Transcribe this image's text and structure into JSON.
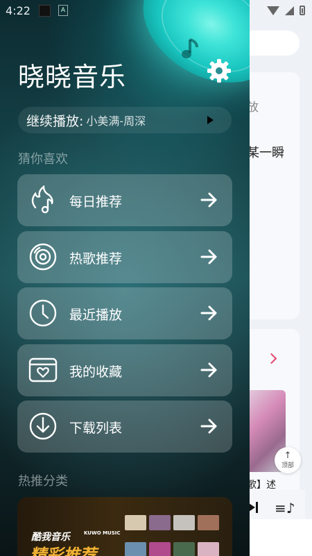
{
  "status_bar": {
    "time": "4:22"
  },
  "drawer": {
    "app_title": "晓晓音乐",
    "continue": {
      "label": "继续播放:",
      "song": "小美满-周深"
    },
    "guess_section": "猜你喜欢",
    "menu": [
      {
        "label": "每日推荐",
        "icon": "fire-music-icon"
      },
      {
        "label": "热歌推荐",
        "icon": "disc-icon"
      },
      {
        "label": "最近播放",
        "icon": "clock-icon"
      },
      {
        "label": "我的收藏",
        "icon": "heart-box-icon"
      },
      {
        "label": "下载列表",
        "icon": "download-icon"
      }
    ],
    "hot_section": "热推分类",
    "banner": {
      "brand": "酷我音乐",
      "brand_en": "KUWO MUSIC",
      "headline": "精彩推荐"
    }
  },
  "background": {
    "card_sub": "放",
    "card_title": "某一瞬",
    "song_text": "歌】述",
    "top_button": "顶部"
  },
  "colors": {
    "accent_disc": "#3ee3d8",
    "drawer_dark": "#154449",
    "chevron": "#e0456c",
    "banner_gold": "#f2b233"
  }
}
